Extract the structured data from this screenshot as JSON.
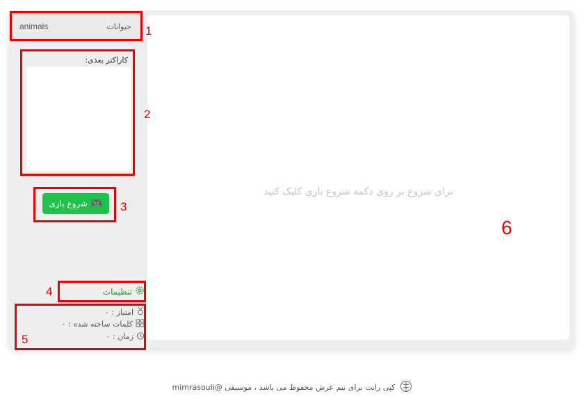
{
  "category": {
    "label": "حیوانات",
    "value": "animals"
  },
  "next_character": {
    "label": "کاراکتر بعدی:"
  },
  "start_button": {
    "label": "شروع بازی",
    "icon": "gamepad-icon"
  },
  "settings": {
    "label": "تنظیمات",
    "icon": "gear-icon"
  },
  "stats": {
    "score": {
      "label": "امتیاز :",
      "value": "۰",
      "icon": "medal-icon"
    },
    "words": {
      "label": "کلمات ساخته شده :",
      "value": "۰",
      "icon": "words-icon"
    },
    "time": {
      "label": "زمان :",
      "value": "۰",
      "icon": "clock-icon"
    }
  },
  "main": {
    "message": "برای شروع بر روی دکمه شروع بازی کلیک کنید"
  },
  "footer": {
    "text": "کپی رایت برای تیم عرش محفوظ می باشد ، موسیقی @mimrasouli",
    "icon": "brain-icon"
  },
  "annotations": [
    "1",
    "2",
    "3",
    "4",
    "5",
    "6"
  ],
  "colors": {
    "accent": "#1fc24a",
    "annotation": "#ee0000",
    "panel": "#eeeeee"
  }
}
